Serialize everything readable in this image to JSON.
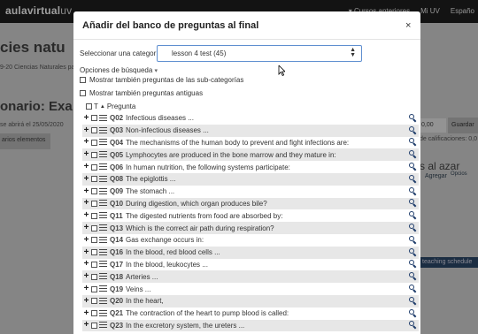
{
  "background": {
    "logo_a": "aula",
    "logo_b": "virtual",
    "logo_c": "uv",
    "top_links": [
      "▾ Cursos anteriores",
      "Mi UV",
      "Españo"
    ],
    "course_title": "cies natu",
    "breadcrumb": "9-20 Ciencias Naturales pa",
    "quiz_title": "onario: Exa",
    "opens_text": "se abrirá el 25/05/2020",
    "edit_button": "arios elementos",
    "max_grade_value": "0,00",
    "save_button": "Guardar",
    "grades_text": "de calificaciones: 0,0",
    "random_text": "s al azar",
    "agregar_link": "Agregar",
    "opciones_link": "Opcios",
    "schedule_tab": "teaching schedule"
  },
  "modal": {
    "title": "Añadir del banco de preguntas al final",
    "close": "×",
    "category_label": "Seleccionar una categoría:",
    "category_value": "lesson 4 test (45)",
    "search_options": "Opciones de búsqueda",
    "subcategories_label": "Mostrar también preguntas de las sub-categorías",
    "old_questions_label": "Mostrar también preguntas antiguas",
    "col_type": "T",
    "col_question": "Pregunta",
    "questions": [
      {
        "num": "Q02",
        "text": "Infectious diseases ..."
      },
      {
        "num": "Q03",
        "text": "Non-infectious diseases ..."
      },
      {
        "num": "Q04",
        "text": "The mechanisms of the human body to prevent and fight infections are:"
      },
      {
        "num": "Q05",
        "text": "Lymphocytes are produced in the bone marrow and they mature in:"
      },
      {
        "num": "Q06",
        "text": "In human nutrition, the following systems participate:"
      },
      {
        "num": "Q08",
        "text": "The epiglottis ..."
      },
      {
        "num": "Q09",
        "text": "The stomach ..."
      },
      {
        "num": "Q10",
        "text": "During digestion, which organ produces bile?"
      },
      {
        "num": "Q11",
        "text": "The digested nutrients from food are absorbed by:"
      },
      {
        "num": "Q13",
        "text": "Which is the correct air path during respiration?"
      },
      {
        "num": "Q14",
        "text": "Gas exchange occurs in:"
      },
      {
        "num": "Q16",
        "text": "In the blood, red blood cells ..."
      },
      {
        "num": "Q17",
        "text": "In the blood, leukocytes ..."
      },
      {
        "num": "Q18",
        "text": "Arteries ..."
      },
      {
        "num": "Q19",
        "text": "Veins ..."
      },
      {
        "num": "Q20",
        "text": "In the heart,"
      },
      {
        "num": "Q21",
        "text": "The contraction of the heart to pump blood is called:"
      },
      {
        "num": "Q23",
        "text": "In the excretory system, the ureters ..."
      }
    ]
  }
}
